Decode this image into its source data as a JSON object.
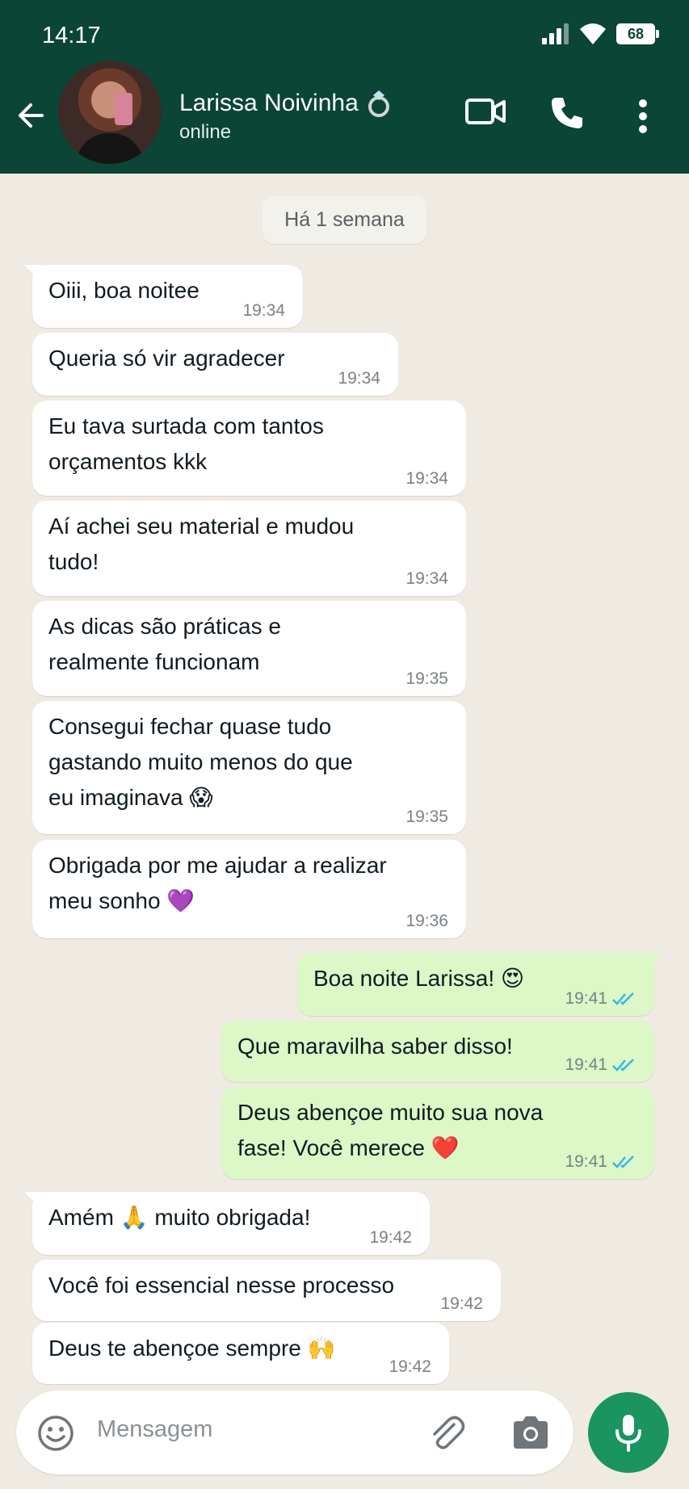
{
  "status_bar": {
    "time": "14:17",
    "battery": "68"
  },
  "header": {
    "contact_name": "Larissa Noivinha",
    "contact_status": "online"
  },
  "date_pill": "Há 1 semana",
  "messages": [
    {
      "text": "Oiii, boa noitee",
      "time": "19:34"
    },
    {
      "text": "Queria só vir agradecer",
      "time": "19:34"
    },
    {
      "line1": "Eu tava surtada com tantos",
      "line2": "orçamentos kkk",
      "time": "19:34"
    },
    {
      "line1": "Aí achei seu material e mudou",
      "line2": "tudo!",
      "time": "19:34"
    },
    {
      "line1": "As dicas são práticas e",
      "line2": "realmente funcionam",
      "time": "19:35"
    },
    {
      "line1": "Consegui fechar quase tudo",
      "line2": "gastando muito menos do que",
      "line3": "eu imaginava",
      "emoji": "😱",
      "time": "19:35"
    },
    {
      "line1": "Obrigada por me ajudar a realizar",
      "line2": "meu sonho",
      "emoji": "💜",
      "time": "19:36"
    },
    {
      "text": "Boa noite Larissa!",
      "emoji": "😍",
      "time": "19:41"
    },
    {
      "text": "Que maravilha saber disso!",
      "time": "19:41"
    },
    {
      "line1": "Deus abençoe muito sua nova",
      "line2": "fase! Você merece",
      "emoji": "❤️",
      "time": "19:41"
    },
    {
      "text_a": "Amém",
      "emoji": "🙏",
      "text_b": "muito obrigada!",
      "time": "19:42"
    },
    {
      "text": "Você foi essencial nesse processo",
      "time": "19:42"
    },
    {
      "text": "Deus te abençoe sempre",
      "emoji": "🙌",
      "time": "19:42"
    }
  ],
  "input": {
    "placeholder": "Mensagem"
  },
  "colors": {
    "header": "#0b4535",
    "outgoing_bubble": "#dcf8c6",
    "incoming_bubble": "#ffffff",
    "mic_button": "#1a9460",
    "read_ticks": "#34b7f1"
  }
}
